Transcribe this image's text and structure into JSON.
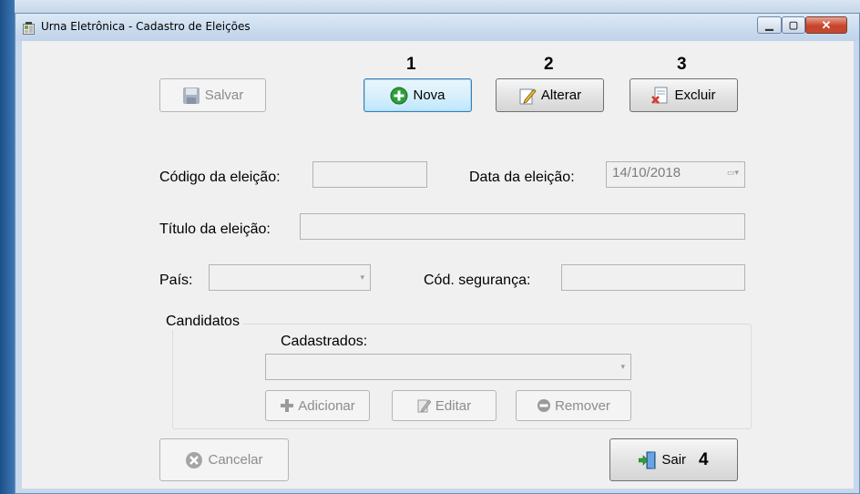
{
  "window": {
    "title": "Urna Eletrônica - Cadastro de Eleições"
  },
  "toolbar": {
    "salvar": "Salvar",
    "nova": "Nova",
    "alterar": "Alterar",
    "excluir": "Excluir"
  },
  "annotations": {
    "n1": "1",
    "n2": "2",
    "n3": "3",
    "n4": "4"
  },
  "form": {
    "codigo_label": "Código da eleição:",
    "codigo_value": "",
    "data_label": "Data da eleição:",
    "data_value": "14/10/2018",
    "titulo_label": "Título da eleição:",
    "titulo_value": "",
    "pais_label": "País:",
    "pais_value": "",
    "seguranca_label": "Cód. segurança:",
    "seguranca_value": ""
  },
  "candidatos": {
    "group_label": "Candidatos",
    "cadastrados_label": "Cadastrados:",
    "cadastrados_value": "",
    "adicionar": "Adicionar",
    "editar": "Editar",
    "remover": "Remover"
  },
  "footer": {
    "cancelar": "Cancelar",
    "sair": "Sair"
  },
  "icons": {
    "save": "floppy-disk-icon",
    "new": "green-plus-circle-icon",
    "edit": "pencil-document-icon",
    "delete": "document-red-x-icon",
    "cancel": "grey-x-circle-icon",
    "exit": "door-green-arrow-icon",
    "add": "grey-plus-icon",
    "remove": "grey-minus-circle-icon"
  },
  "colors": {
    "green": "#2e9e3a",
    "red": "#d9362a",
    "focus_blue": "#3c7fb1"
  }
}
